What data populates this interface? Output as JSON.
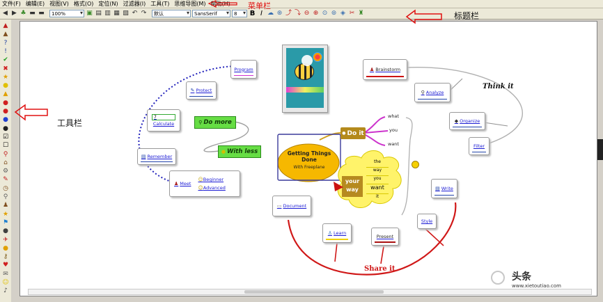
{
  "menu": [
    "文件(F)",
    "编辑(E)",
    "视图(V)",
    "格式(O)",
    "定位(N)",
    "过滤器(I)",
    "工具(T)",
    "思维导图(M)",
    "帮助(H)"
  ],
  "toolbar": {
    "zoom": "100%",
    "style": "默认",
    "font": "SansSerif",
    "size": "8",
    "bold": "B",
    "italic": "I"
  },
  "annotations": {
    "menubar": "菜单栏",
    "titlebar": "标题栏",
    "toolbar": "工具栏"
  },
  "mindmap": {
    "center": {
      "title": "Getting Things Done",
      "subtitle": "With Freeplane"
    },
    "do_it": "Do it",
    "do_it_items": [
      "what",
      "you",
      "want"
    ],
    "your_way": "your way",
    "your_way_items": [
      "the",
      "way",
      "you",
      "want",
      "it"
    ],
    "do_more": "Do more",
    "with_less": "With less",
    "left_nodes": {
      "program": "Program",
      "protect": "Protect",
      "calculate": "Calculate",
      "calculate_value": "7",
      "remember": "Remember",
      "meet": "Meet",
      "beginner": "Beginner",
      "advanced": "Advanced"
    },
    "right_nodes": {
      "brainstorm": "Brainstorm",
      "analyze": "Analyze",
      "think_it": "Think it",
      "organize": "Organize",
      "filter": "Filter",
      "write": "Write",
      "style": "Style"
    },
    "bottom_nodes": {
      "document": "Document",
      "learn": "Learn",
      "present": "Present",
      "share_it": "Share it"
    }
  },
  "watermark": {
    "brand": "头条",
    "url": "www.xietoutiao.com"
  },
  "colors": {
    "annotation_red": "#e01010",
    "dotted_blue": "#2222bb",
    "share_red": "#d01818",
    "do_it_purple": "#cc33cc"
  }
}
